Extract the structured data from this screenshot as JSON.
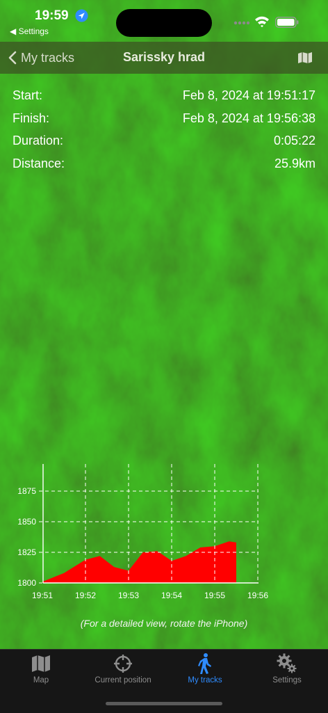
{
  "status_bar": {
    "time": "19:59",
    "back_app": "◀ Settings"
  },
  "nav": {
    "back_label": "My tracks",
    "title": "Sarissky hrad"
  },
  "info": [
    {
      "label": "Start:",
      "value": "Feb 8, 2024 at 19:51:17"
    },
    {
      "label": "Finish:",
      "value": "Feb 8, 2024 at 19:56:38"
    },
    {
      "label": "Duration:",
      "value": "0:05:22"
    },
    {
      "label": "Distance:",
      "value": "25.9km"
    }
  ],
  "chart_data": {
    "type": "area",
    "x": [
      "19:51",
      "19:51:30",
      "19:52",
      "19:52:20",
      "19:52:40",
      "19:53",
      "19:53:20",
      "19:53:40",
      "19:54",
      "19:54:20",
      "19:54:40",
      "19:55",
      "19:55:20",
      "19:55:30"
    ],
    "y": [
      1801,
      1808,
      1819,
      1822,
      1813,
      1810,
      1825,
      1826,
      1818,
      1822,
      1829,
      1830,
      1834,
      1833
    ],
    "x_ticks": [
      "19:51",
      "19:52",
      "19:53",
      "19:54",
      "19:55",
      "19:56"
    ],
    "y_ticks": [
      "1800",
      "1825",
      "1850",
      "1875"
    ],
    "ylim": [
      1800,
      1875
    ],
    "grid": true,
    "fill_color": "#ff0000"
  },
  "chart_note": "(For a detailed view, rotate the iPhone)",
  "tabs": [
    {
      "label": "Map",
      "icon": "map-icon"
    },
    {
      "label": "Current position",
      "icon": "crosshair-icon"
    },
    {
      "label": "My tracks",
      "icon": "walking-icon",
      "active": true
    },
    {
      "label": "Settings",
      "icon": "gear-icon"
    }
  ],
  "colors": {
    "accent": "#2f8cff",
    "map_green": "#1f5a0d"
  }
}
